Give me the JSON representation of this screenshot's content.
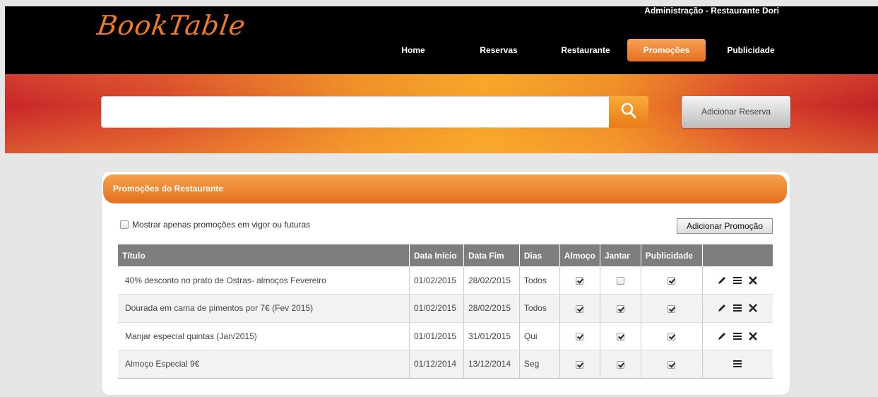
{
  "header": {
    "logo": "BookTable",
    "admin_title": "Administração - Restaurante Dori",
    "nav": [
      {
        "label": "Home"
      },
      {
        "label": "Reservas"
      },
      {
        "label": "Restaurante"
      },
      {
        "label": "Promoções",
        "active": true
      },
      {
        "label": "Publicidade"
      }
    ]
  },
  "search": {
    "value": "",
    "placeholder": "",
    "button_icon": "search-icon",
    "add_reserva_label": "Adicionar Reserva"
  },
  "panel": {
    "title": "Promoções do Restaurante",
    "filter_label": "Mostrar apenas promoções em vigor ou futuras",
    "filter_checked": false,
    "add_button_label": "Adicionar Promoção",
    "columns": [
      "Título",
      "Data Início",
      "Data Fim",
      "Dias",
      "Almoço",
      "Jantar",
      "Publicidade",
      ""
    ],
    "rows": [
      {
        "titulo": "40% desconto no prato de Ostras- almoços Fevereiro",
        "inicio": "01/02/2015",
        "fim": "28/02/2015",
        "dias": "Todos",
        "almoco": true,
        "jantar": false,
        "publicidade": true,
        "actions": [
          "edit-icon",
          "list-icon",
          "delete-icon"
        ]
      },
      {
        "titulo": "Dourada em cama de pimentos por 7€ (Fev 2015)",
        "inicio": "01/02/2015",
        "fim": "28/02/2015",
        "dias": "Todos",
        "almoco": true,
        "jantar": true,
        "publicidade": true,
        "actions": [
          "edit-icon",
          "list-icon",
          "delete-icon"
        ]
      },
      {
        "titulo": "Manjar especial quintas (Jan/2015)",
        "inicio": "01/01/2015",
        "fim": "31/01/2015",
        "dias": "Qui",
        "almoco": true,
        "jantar": true,
        "publicidade": true,
        "actions": [
          "edit-icon",
          "list-icon",
          "delete-icon"
        ]
      },
      {
        "titulo": "Almoço Especial 9€",
        "inicio": "01/12/2014",
        "fim": "13/12/2014",
        "dias": "Seg",
        "almoco": true,
        "jantar": true,
        "publicidade": true,
        "actions": [
          "list-icon"
        ]
      }
    ]
  },
  "colors": {
    "accent": "#ef7a25",
    "header_bg": "#000000",
    "table_header_bg": "#7e7e7e"
  }
}
